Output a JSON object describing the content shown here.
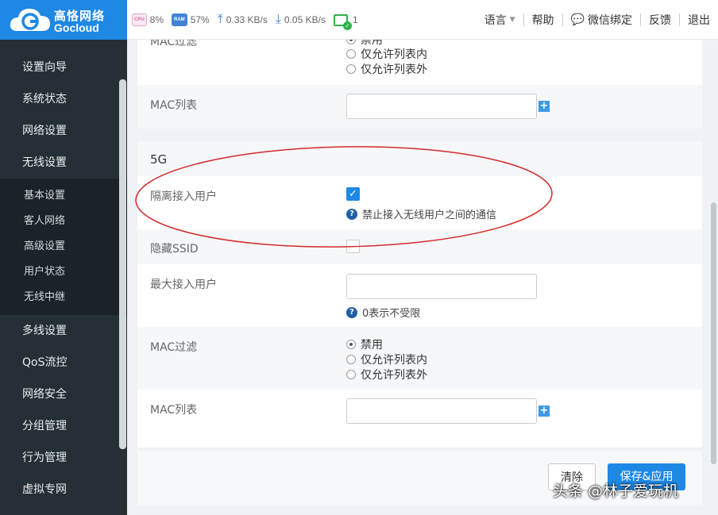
{
  "brand": {
    "name_cn": "高恪网络",
    "name_en": "Gocloud",
    "color": "#1e88e5"
  },
  "status": {
    "cpu_chip": "CPU",
    "cpu": "8%",
    "ram_chip": "RAM",
    "ram": "57%",
    "upload": "0.33 KB/s",
    "download": "0.05 KB/s",
    "devices": "1"
  },
  "topnav": {
    "language": "语言",
    "help": "帮助",
    "wechat": "微信绑定",
    "feedback": "反馈",
    "logout": "退出"
  },
  "sidebar": {
    "items": [
      "设置向导",
      "系统状态",
      "网络设置",
      "无线设置"
    ],
    "sub_items": [
      "基本设置",
      "客人网络",
      "高级设置",
      "用户状态",
      "无线中继"
    ],
    "items_after": [
      "多线设置",
      "QoS流控",
      "网络安全",
      "分组管理",
      "行为管理",
      "虚拟专网"
    ]
  },
  "section_24g": {
    "mac_filter_label": "MAC过滤",
    "mac_filter_options": [
      "禁用",
      "仅允许列表内",
      "仅允许列表外"
    ],
    "mac_list_label": "MAC列表"
  },
  "section_5g": {
    "title": "5G",
    "isolate_label": "隔离接入用户",
    "isolate_help": "禁止接入无线用户之间的通信",
    "isolate_checked": true,
    "hide_ssid_label": "隐藏SSID",
    "hide_ssid_checked": false,
    "max_users_label": "最大接入用户",
    "max_users_help": "0表示不受限",
    "mac_filter_label": "MAC过滤",
    "mac_filter_options": [
      "禁用",
      "仅允许列表内",
      "仅允许列表外"
    ],
    "mac_filter_selected": "禁用",
    "mac_list_label": "MAC列表"
  },
  "buttons": {
    "clear": "清除",
    "save": "保存&应用"
  },
  "watermark": "头条 @林子爱玩机",
  "annotation_color": "#d42a2a"
}
